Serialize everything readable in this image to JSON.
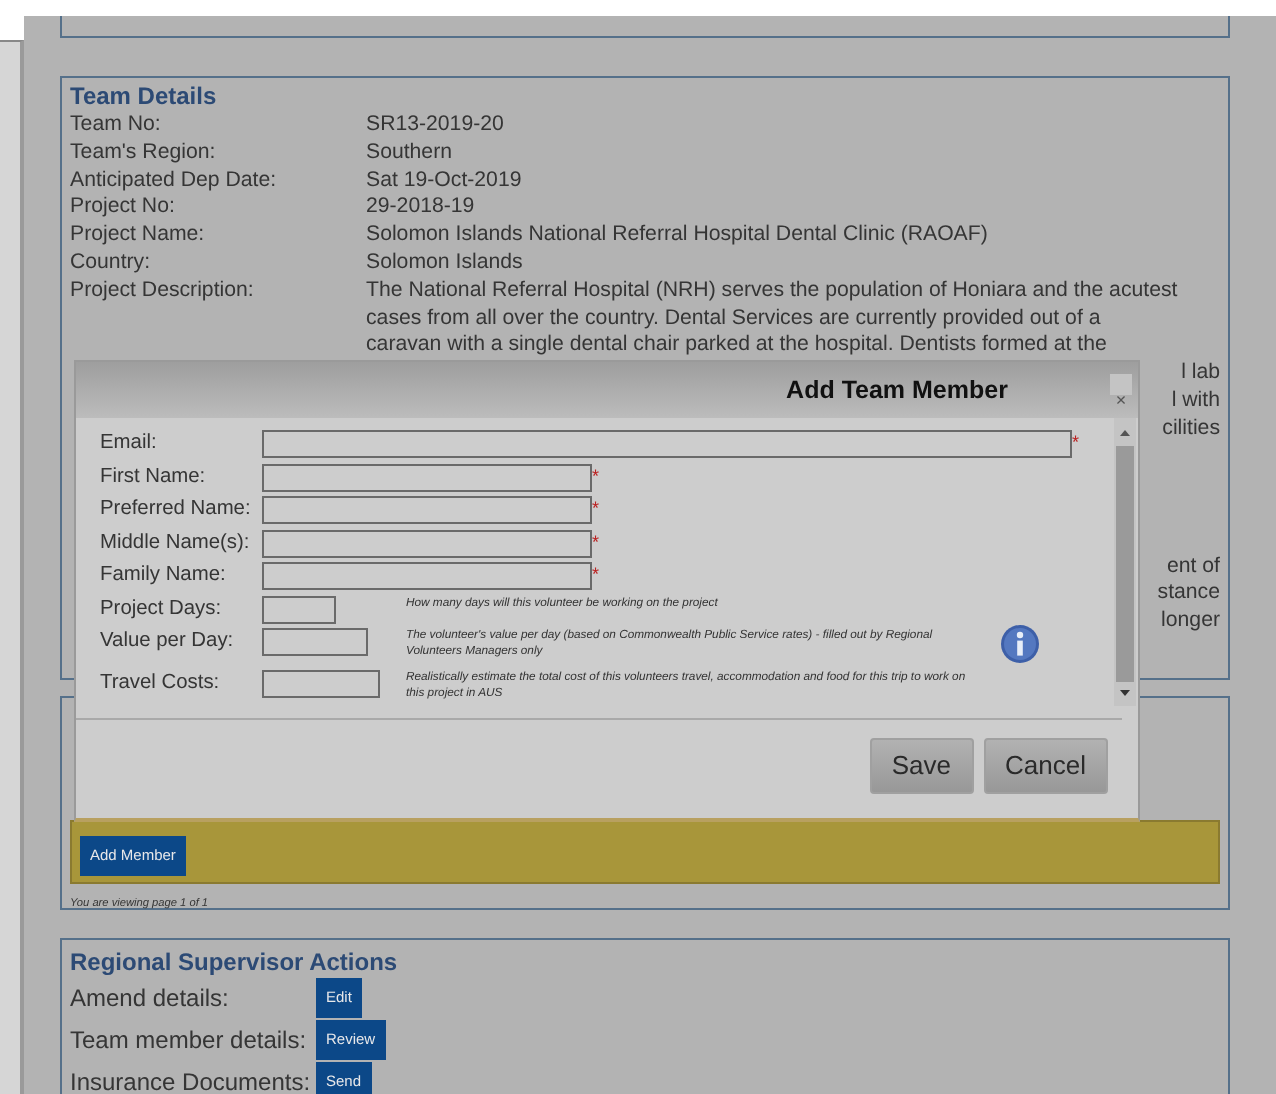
{
  "team_details": {
    "legend": "Team Details",
    "fields": [
      {
        "label": "Team No:",
        "value": "SR13-2019-20"
      },
      {
        "label": "Team's Region:",
        "value": "Southern"
      },
      {
        "label": "Anticipated Dep Date:",
        "value": "Sat 19-Oct-2019"
      },
      {
        "label": "Project No:",
        "value": "29-2018-19"
      },
      {
        "label": "Project Name:",
        "value": "Solomon Islands National Referral Hospital Dental Clinic (RAOAF)"
      },
      {
        "label": "Country:",
        "value": "Solomon Islands"
      }
    ],
    "description": {
      "label": "Project Description:",
      "lines": [
        "The National Referral Hospital (NRH) serves the population of Honiara and the acutest",
        "cases from all over the country. Dental Services are currently provided out of a",
        "caravan with a single dental chair parked at the hospital. Dentists formed at the"
      ],
      "continuation_groups": [
        [
          "l lab",
          "l with",
          "cilities"
        ],
        [
          "ent of",
          "stance",
          "longer"
        ]
      ]
    }
  },
  "team_members": {
    "add_button": "Add Member",
    "paging": "You are viewing page 1 of 1"
  },
  "supervisor_actions": {
    "legend": "Regional Supervisor Actions",
    "rows": [
      {
        "label": "Amend details:",
        "button": "Edit"
      },
      {
        "label": "Team member details:",
        "button": "Review"
      },
      {
        "label": "Insurance Documents:",
        "button": "Send"
      }
    ]
  },
  "dialog": {
    "title": "Add Team Member",
    "close": "×",
    "required_marker": "*",
    "fields": [
      {
        "label": "Email:",
        "kind": "wide",
        "required": true
      },
      {
        "label": "First Name:",
        "kind": "name",
        "required": true
      },
      {
        "label": "Preferred Name:",
        "kind": "name",
        "required": true
      },
      {
        "label": "Middle Name(s):",
        "kind": "name",
        "required": true
      },
      {
        "label": "Family Name:",
        "kind": "name",
        "required": true
      },
      {
        "label": "Project Days:",
        "kind": "days",
        "required": false,
        "hint": "How many days will this volunteer be working on the project"
      },
      {
        "label": "Value per Day:",
        "kind": "value",
        "required": false,
        "hint": "The volunteer's value per day (based on Commonwealth Public Service rates) - filled out by Regional Volunteers Managers only"
      },
      {
        "label": "Travel Costs:",
        "kind": "travel",
        "required": false,
        "hint": "Realistically estimate the total cost of this volunteers travel, accommodation and food for this trip to work on this project in AUS"
      }
    ],
    "buttons": [
      "Save",
      "Cancel"
    ]
  }
}
